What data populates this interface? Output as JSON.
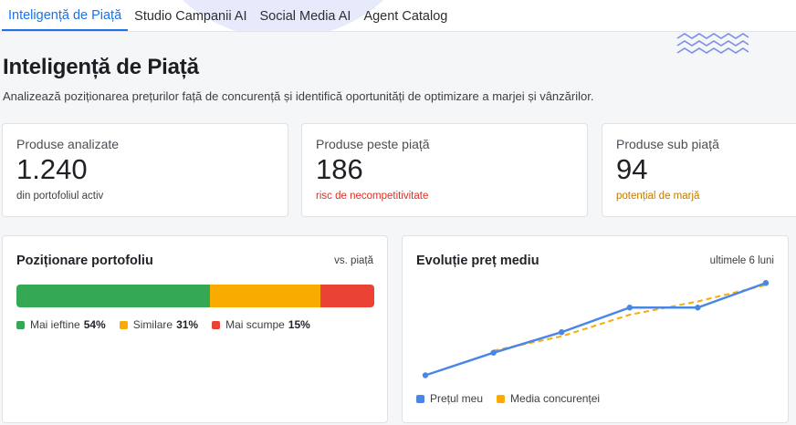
{
  "tabs": [
    {
      "label": "Inteligență de Piață",
      "active": true
    },
    {
      "label": "Studio Campanii AI",
      "active": false
    },
    {
      "label": "Social Media AI",
      "active": false
    },
    {
      "label": "Agent Catalog",
      "active": false
    }
  ],
  "header": {
    "title": "Inteligență de Piață",
    "subtitle": "Analizează poziționarea prețurilor față de concurență și identifică oportunități de optimizare a marjei și vânzărilor."
  },
  "kpis": [
    {
      "label": "Produse analizate",
      "value": "1.240",
      "note": "din portofoliul activ"
    },
    {
      "label": "Produse peste piață",
      "value": "186",
      "note": "risc de necompetitivitate"
    },
    {
      "label": "Produse sub piață",
      "value": "94",
      "note": "potențial de marjă"
    }
  ],
  "positioning": {
    "title": "Poziționare portofoliu",
    "meta": "vs. piață",
    "segments": [
      {
        "label": "Mai ieftine",
        "pct_label": "54%",
        "value": 54,
        "color": "#34a853"
      },
      {
        "label": "Similare",
        "pct_label": "31%",
        "value": 31,
        "color": "#f9ab00"
      },
      {
        "label": "Mai scumpe",
        "pct_label": "15%",
        "value": 15,
        "color": "#ea4335"
      }
    ]
  },
  "evolution": {
    "title": "Evoluție preț mediu",
    "meta": "ultimele 6 luni",
    "legend": {
      "own": "Prețul meu",
      "market": "Media concurenței"
    },
    "colors": {
      "own": "#4a86e8",
      "market": "#f9ab00"
    }
  },
  "chart_data": {
    "type": "line",
    "x": [
      1,
      2,
      3,
      4,
      5,
      6
    ],
    "series": [
      {
        "name": "Prețul meu",
        "values": [
          20,
          42,
          62,
          86,
          86,
          110
        ]
      },
      {
        "name": "Media concurenței",
        "values": [
          null,
          44,
          58,
          79,
          92,
          108
        ]
      }
    ],
    "ylim": [
      0,
      120
    ],
    "grid": false,
    "legend": "bottom-left"
  },
  "colors": {
    "accent": "#1a73e8",
    "danger": "#d93025",
    "warning": "#c07a00"
  }
}
